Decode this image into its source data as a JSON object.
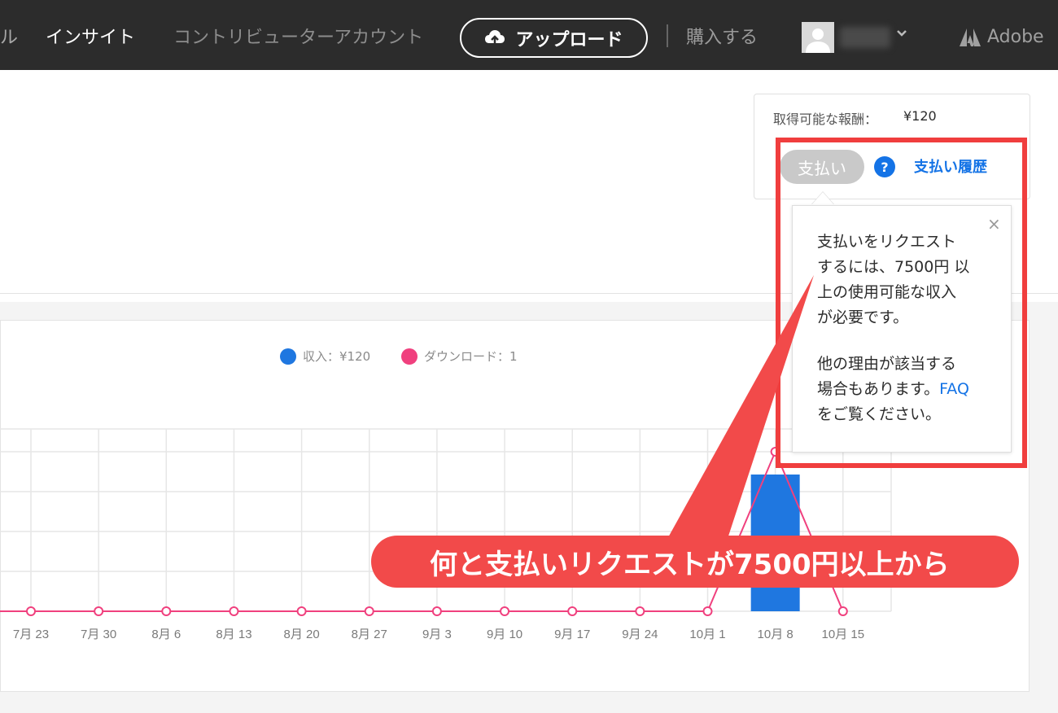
{
  "topnav": {
    "partial_item": "ル",
    "insight": "インサイト",
    "contributor_account": "コントリビューターアカウント",
    "upload": "アップロード",
    "buy": "購入する",
    "brand": "Adobe"
  },
  "earnings": {
    "label": "取得可能な報酬：",
    "value": "¥120",
    "pay_button": "支払い",
    "help": "?",
    "history_link": "支払い履歴"
  },
  "popover": {
    "close": "×",
    "lines": [
      "支払いをリクエスト",
      "するには、7500円 以",
      "上の使用可能な収入",
      "が必要です。"
    ],
    "other_line1": "他の理由が該当する",
    "other_line2": "場合もあります。",
    "faq": "FAQ",
    "other_line3": "をご覧ください。"
  },
  "legend": {
    "income": "収入：¥120",
    "downloads": "ダウンロード：1"
  },
  "colors": {
    "income": "#1f77e0",
    "downloads": "#f0407e",
    "annotation": "#f24a4a"
  },
  "annotation": {
    "callout": "何と支払いリクエストが7500円以上から"
  },
  "chart_data": {
    "type": "bar",
    "categories": [
      "7月 23",
      "7月 30",
      "8月 6",
      "8月 13",
      "8月 20",
      "8月 27",
      "9月 3",
      "9月 10",
      "9月 17",
      "9月 24",
      "10月 1",
      "10月 8",
      "10月 15"
    ],
    "series": [
      {
        "name": "収入",
        "type": "bar",
        "values": [
          0,
          0,
          0,
          0,
          0,
          0,
          0,
          0,
          0,
          0,
          0,
          120,
          0
        ]
      },
      {
        "name": "ダウンロード",
        "type": "line",
        "values": [
          0,
          0,
          0,
          0,
          0,
          0,
          0,
          0,
          0,
          0,
          0,
          1,
          0
        ]
      }
    ],
    "y2_ticks": [
      "0.5",
      "0.75",
      "1"
    ],
    "y2lim": [
      0,
      1
    ],
    "grid": true
  }
}
